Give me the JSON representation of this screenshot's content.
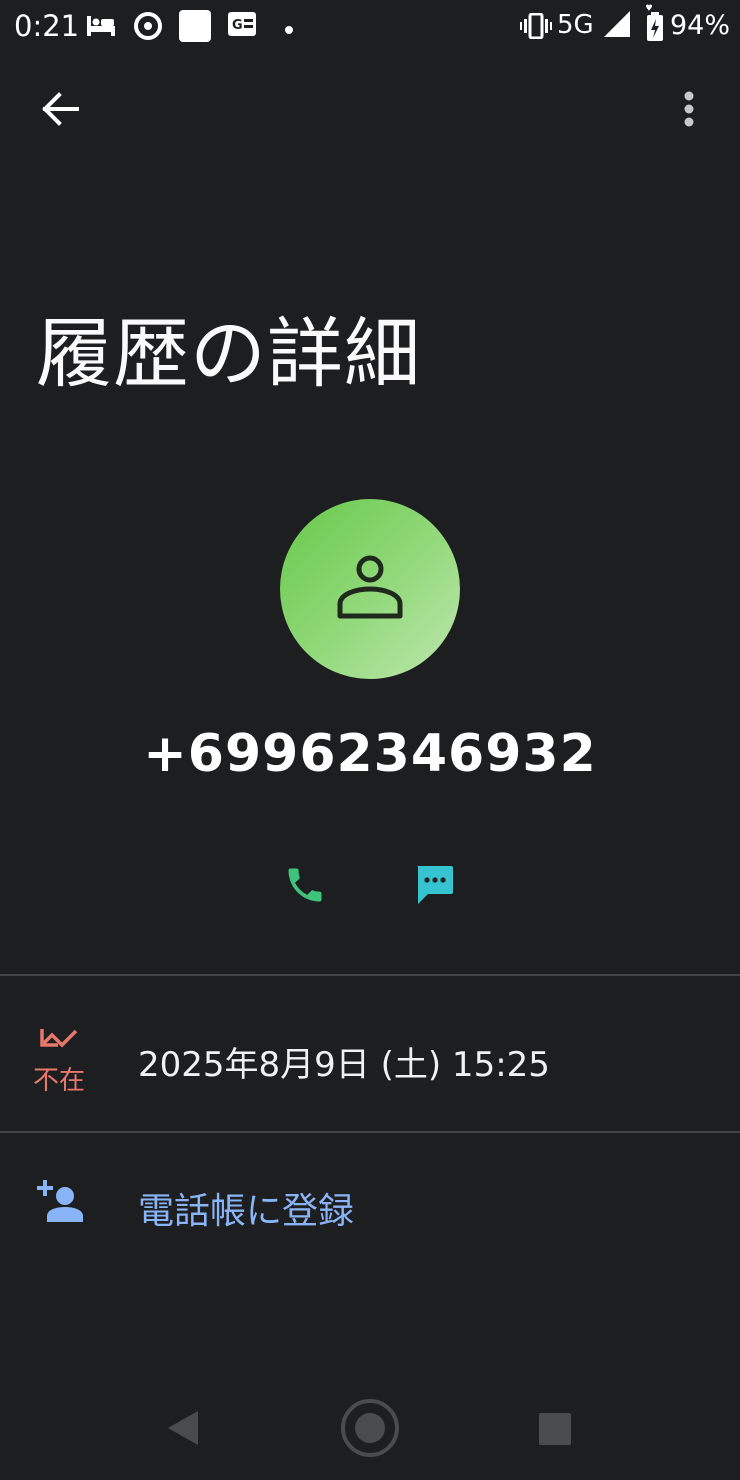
{
  "status_bar": {
    "time": "0:21",
    "network": "5G",
    "battery": "94%",
    "icons": [
      "sleep-icon",
      "chrome-icon",
      "square-notification-icon",
      "ge-news-icon",
      "dot-icon",
      "vibrate-icon",
      "signal-icon",
      "battery-charging-icon"
    ]
  },
  "header": {
    "back_icon": "arrow-back-icon",
    "menu_icon": "more-vert-icon"
  },
  "page": {
    "title": "履歴の詳細"
  },
  "contact": {
    "avatar_icon": "person-icon",
    "avatar_color": "#7dd36a",
    "phone_number": "+69962346932"
  },
  "actions": {
    "call_icon": "phone-icon",
    "message_icon": "message-icon",
    "call_color": "#3ec47a",
    "message_color": "#35c4d0"
  },
  "call_log": {
    "type_label": "不在",
    "type_icon": "missed-call-icon",
    "datetime": "2025年8月9日 (土) 15:25",
    "missed_color": "#e8776c"
  },
  "add_contact": {
    "label": "電話帳に登録",
    "icon": "person-add-icon",
    "color": "#8ab4f8"
  },
  "nav_bar": {
    "icons": [
      "nav-back-icon",
      "nav-home-icon",
      "nav-recents-icon"
    ]
  }
}
